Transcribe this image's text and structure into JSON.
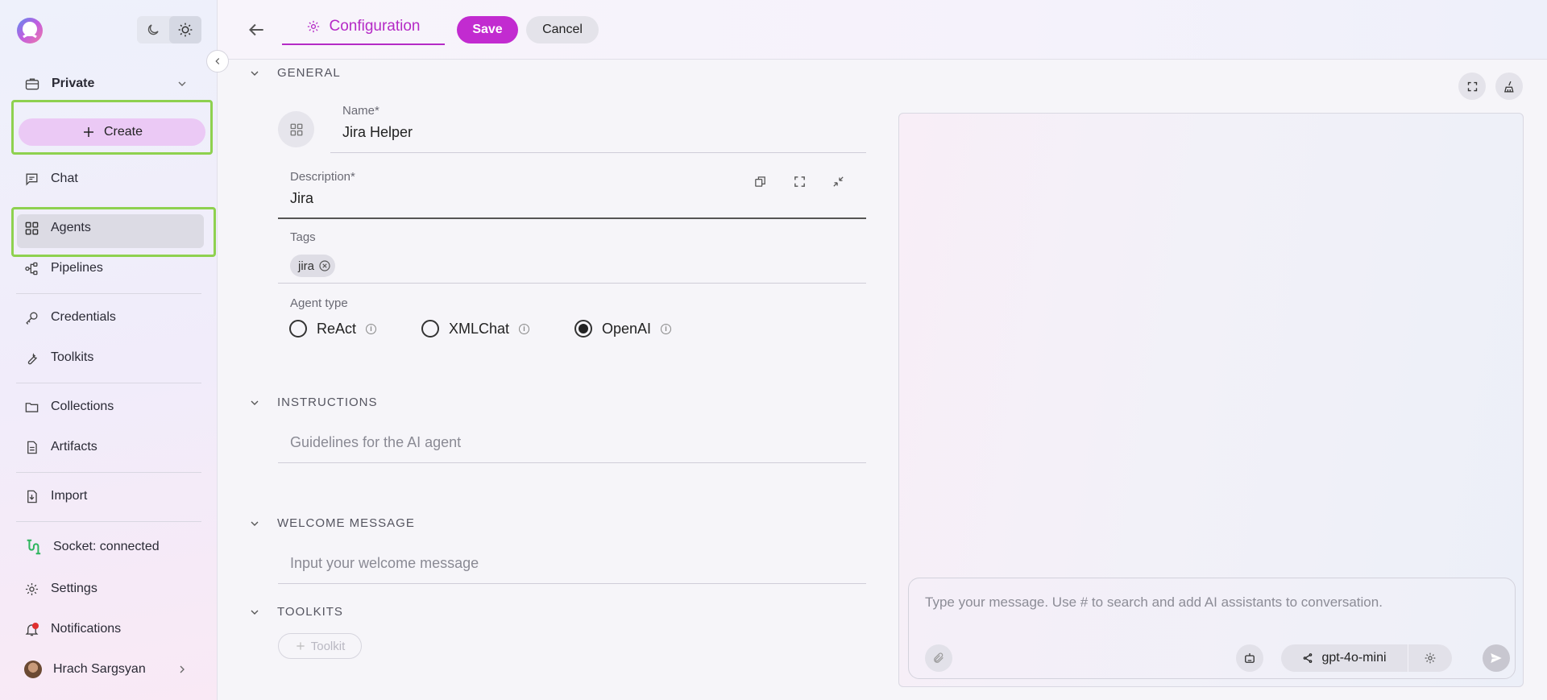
{
  "sidebar": {
    "workspace": "Private",
    "create_label": "Create",
    "items": {
      "chat": "Chat",
      "agents": "Agents",
      "pipelines": "Pipelines",
      "credentials": "Credentials",
      "toolkits": "Toolkits",
      "collections": "Collections",
      "artifacts": "Artifacts",
      "import": "Import",
      "socket": "Socket: connected",
      "settings": "Settings",
      "notifications": "Notifications",
      "user": "Hrach Sargsyan"
    }
  },
  "topbar": {
    "tab_label": "Configuration",
    "save_label": "Save",
    "cancel_label": "Cancel"
  },
  "form": {
    "general_title": "GENERAL",
    "name_label": "Name*",
    "name_value": "Jira Helper",
    "description_label": "Description*",
    "description_value": "Jira",
    "tags_label": "Tags",
    "tags": [
      "jira"
    ],
    "agent_type_label": "Agent type",
    "agent_types": [
      "ReAct",
      "XMLChat",
      "OpenAI"
    ],
    "agent_type_selected": "OpenAI",
    "instructions_title": "INSTRUCTIONS",
    "instructions_placeholder": "Guidelines for the AI agent",
    "welcome_title": "WELCOME MESSAGE",
    "welcome_placeholder": "Input your welcome message",
    "toolkits_title": "TOOLKITS",
    "toolkit_button": "Toolkit"
  },
  "chat": {
    "input_placeholder": "Type your message. Use # to search and add AI assistants to conversation.",
    "model": "gpt-4o-mini"
  },
  "colors": {
    "accent": "#c22bd0",
    "highlight": "#8ed14f",
    "socket_connected": "#2db55d"
  },
  "icons": [
    "logo-icon",
    "moon-icon",
    "sun-icon",
    "chevron-left-icon",
    "briefcase-icon",
    "chevron-down-icon",
    "plus-icon",
    "chat-icon",
    "grid-icon",
    "pipeline-icon",
    "key-icon",
    "wrench-icon",
    "folder-icon",
    "document-icon",
    "import-icon",
    "socket-icon",
    "gear-icon",
    "bell-icon",
    "chevron-right-icon",
    "arrow-left-icon",
    "expand-icon",
    "broom-icon",
    "copy-icon",
    "collapse-icon",
    "close-circle-icon",
    "info-icon",
    "paperclip-icon",
    "robot-icon",
    "share-icon",
    "send-icon"
  ]
}
